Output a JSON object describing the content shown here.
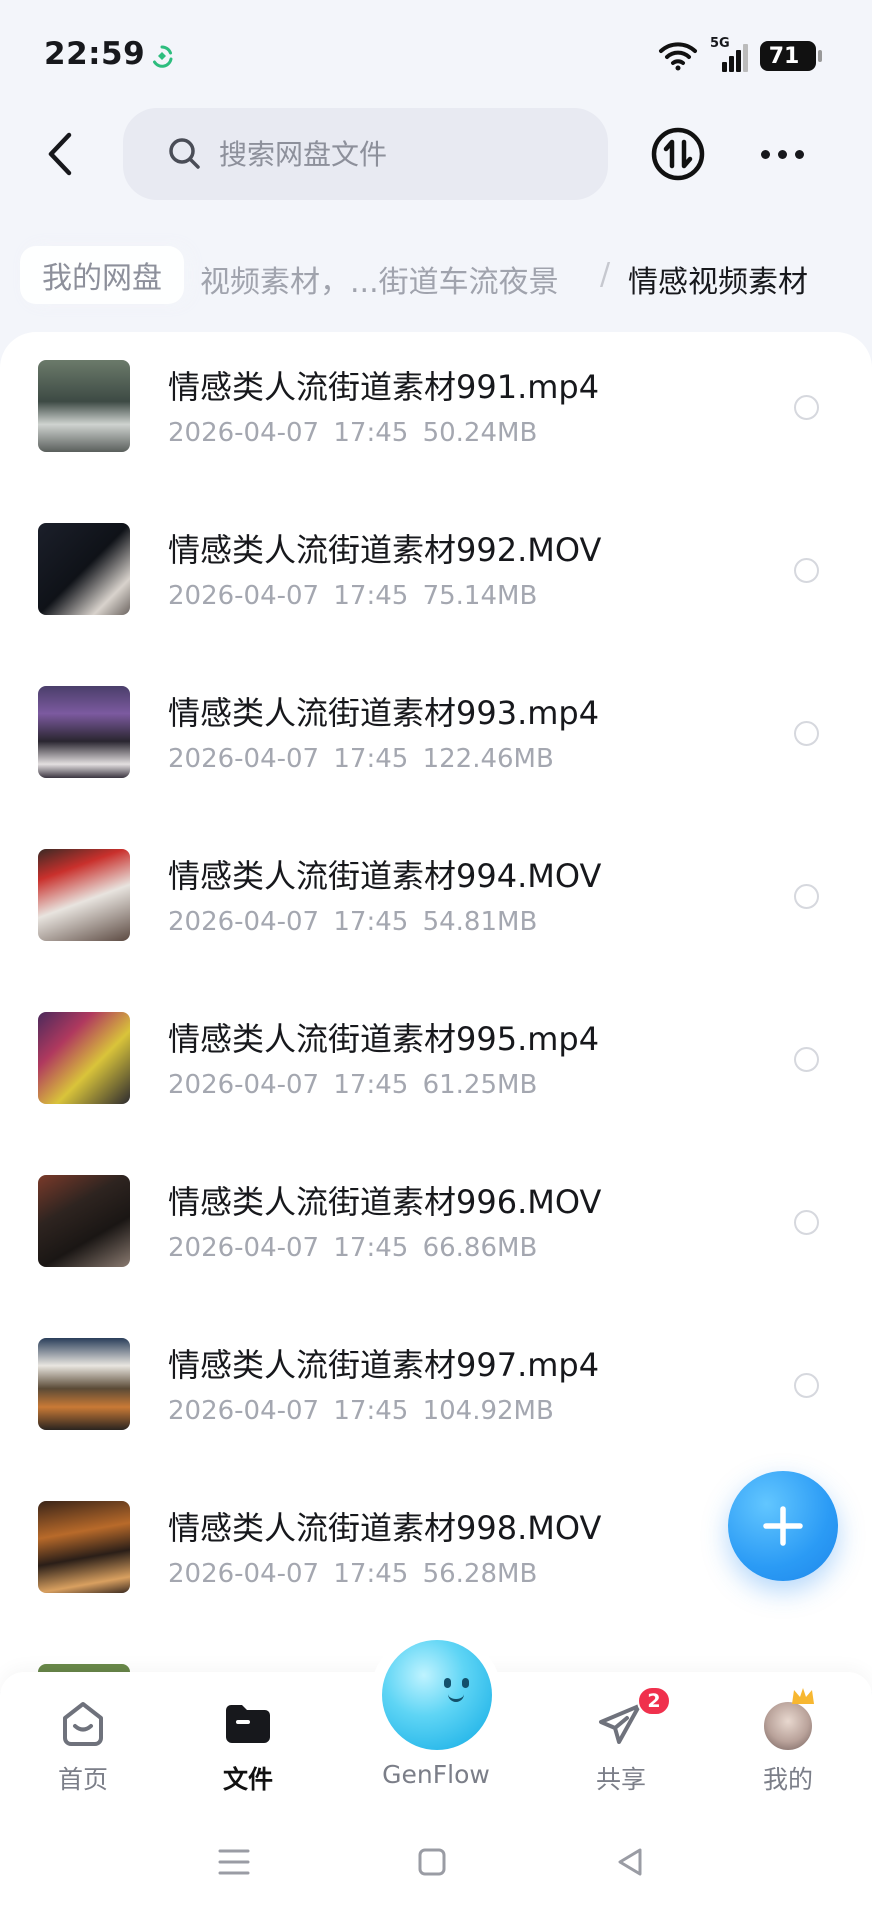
{
  "status_bar": {
    "time": "22:59",
    "battery": "71",
    "network": "5G"
  },
  "header": {
    "search_placeholder": "搜索网盘文件"
  },
  "breadcrumb": {
    "root": "我的网盘",
    "middle": "视频素材，...街道车流夜景",
    "separator": "/",
    "current": "情感视频素材"
  },
  "files": [
    {
      "name": "情感类人流街道素材991.mp4",
      "date": "2026-04-07",
      "time": "17:45",
      "size": "50.24MB"
    },
    {
      "name": "情感类人流街道素材992.MOV",
      "date": "2026-04-07",
      "time": "17:45",
      "size": "75.14MB"
    },
    {
      "name": "情感类人流街道素材993.mp4",
      "date": "2026-04-07",
      "time": "17:45",
      "size": "122.46MB"
    },
    {
      "name": "情感类人流街道素材994.MOV",
      "date": "2026-04-07",
      "time": "17:45",
      "size": "54.81MB"
    },
    {
      "name": "情感类人流街道素材995.mp4",
      "date": "2026-04-07",
      "time": "17:45",
      "size": "61.25MB"
    },
    {
      "name": "情感类人流街道素材996.MOV",
      "date": "2026-04-07",
      "time": "17:45",
      "size": "66.86MB"
    },
    {
      "name": "情感类人流街道素材997.mp4",
      "date": "2026-04-07",
      "time": "17:45",
      "size": "104.92MB"
    },
    {
      "name": "情感类人流街道素材998.MOV",
      "date": "2026-04-07",
      "time": "17:45",
      "size": "56.28MB"
    }
  ],
  "bottom_nav": {
    "home": "首页",
    "files": "文件",
    "genflow": "GenFlow",
    "share": "共享",
    "share_badge": "2",
    "me": "我的"
  },
  "colors": {
    "accent": "#2b9bf5",
    "badge": "#f0314d",
    "text": "#17181c",
    "muted": "#a4a7b0"
  }
}
